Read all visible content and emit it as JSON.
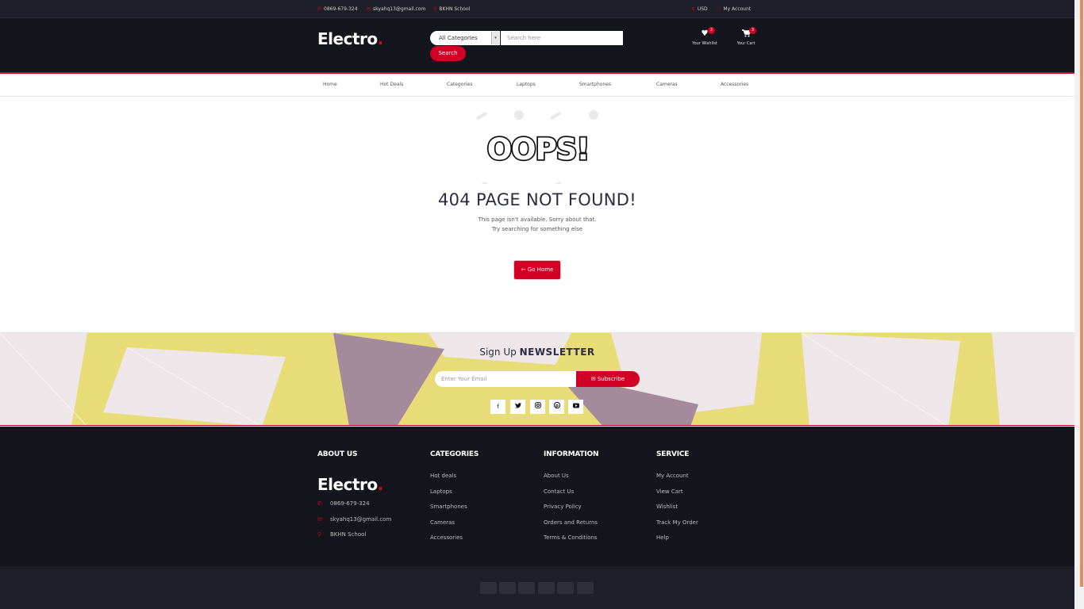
{
  "topbar": {
    "phone": "0869-679-324",
    "email": "skyahq13@gmail.com",
    "address": "BKHN School",
    "currency": "USD",
    "account": "My Account"
  },
  "header": {
    "logo": "Electro",
    "logo_dot": ".",
    "category_select": "All Categories",
    "search_placeholder": "Search here",
    "search_button": "Search",
    "wishlist_label": "Your Wishlist",
    "wishlist_count": "2",
    "cart_label": "Your Cart",
    "cart_count": "3"
  },
  "nav": [
    "Home",
    "Hot Deals",
    "Categories",
    "Laptops",
    "Smartphones",
    "Cameras",
    "Accessories"
  ],
  "error": {
    "oops": "OOPS!",
    "title": "404 PAGE NOT FOUND!",
    "line1": "This page isn't available. Sorry about that.",
    "line2": "Try searching for something else",
    "button": "Go Home"
  },
  "newsletter": {
    "title_light": "Sign Up",
    "title_bold": "NEWSLETTER",
    "placeholder": "Enter Your Email",
    "button": "Subscribe",
    "social": [
      "facebook-icon",
      "twitter-icon",
      "instagram-icon",
      "pinterest-icon",
      "youtube-icon"
    ]
  },
  "footer": {
    "about": {
      "title": "ABOUT US",
      "logo": "Electro",
      "phone": "0869-679-324",
      "email": "skyahq13@gmail.com",
      "address": "BKHN School"
    },
    "categories": {
      "title": "CATEGORIES",
      "links": [
        "Hot deals",
        "Laptops",
        "Smartphones",
        "Cameras",
        "Accessories"
      ]
    },
    "information": {
      "title": "INFORMATION",
      "links": [
        "About Us",
        "Contact Us",
        "Privacy Policy",
        "Orders and Returns",
        "Terms & Conditions"
      ]
    },
    "service": {
      "title": "SERVICE",
      "links": [
        "My Account",
        "View Cart",
        "Wishlist",
        "Track My Order",
        "Help"
      ]
    }
  },
  "colors": {
    "accent": "#d10024",
    "dark": "#15161d",
    "newsletter_bg": "#e8dc78"
  },
  "payment_icons": [
    "visa-icon",
    "credit-card-icon",
    "paypal-icon",
    "mastercard-icon",
    "discover-icon",
    "amex-icon"
  ]
}
